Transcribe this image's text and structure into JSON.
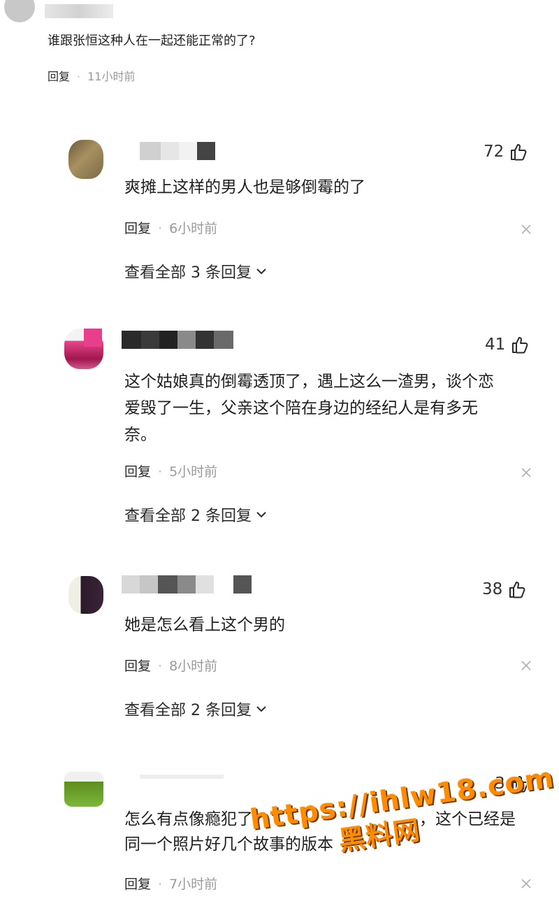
{
  "top_comment": {
    "text": "谁跟张恒这种人在一起还能正常的了?",
    "reply_label": "回复",
    "time": "11小时前"
  },
  "replies": [
    {
      "likes": "72",
      "text": "爽摊上这样的男人也是够倒霉的了",
      "reply_label": "回复",
      "time": "6小时前",
      "expand": "查看全部 3 条回复"
    },
    {
      "likes": "41",
      "text_line1": "这个姑娘真的倒霉透顶了，遇上这么一渣男，谈个恋",
      "text_line2": "爱毁了一生，父亲这个陪在身边的经纪人是有多无",
      "text_line3": "奈。",
      "reply_label": "回复",
      "time": "5小时前",
      "expand": "查看全部 2 条回复"
    },
    {
      "likes": "38",
      "text": "她是怎么看上这个男的",
      "reply_label": "回复",
      "time": "8小时前",
      "expand": "查看全部 2 条回复"
    },
    {
      "likes": "3",
      "text_line1": "怎么有点像瘾犯了",
      "text_line1b": "，这个已经是",
      "text_line2": "同一个照片好几个故事的版本",
      "reply_label": "回复",
      "time": "7小时前"
    }
  ],
  "watermark": {
    "url": "https://ihlw18.com",
    "name": "黑料网"
  },
  "colors": {
    "like_icon": "#2b2b2b",
    "meta_gray": "#9a9a9a",
    "watermark": "#ff8c00"
  },
  "icons": [
    "thumbs-up-icon",
    "close-icon",
    "chevron-down-icon"
  ]
}
